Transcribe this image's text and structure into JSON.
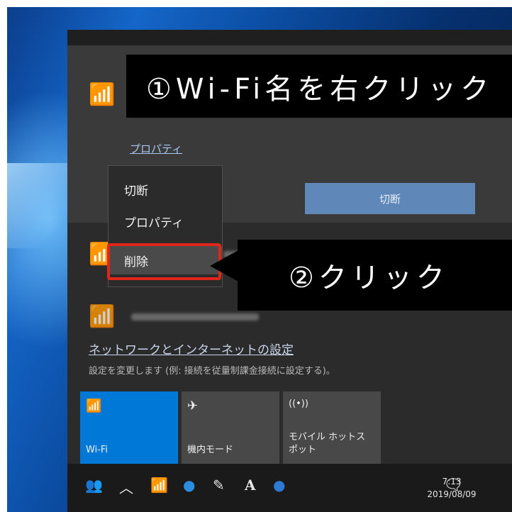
{
  "callouts": {
    "step1": "①Wi-Fi名を右クリック",
    "step2": "②クリック"
  },
  "flyout": {
    "property_link": "プロパティ",
    "disconnect_button": "切断",
    "context_menu": {
      "items": [
        {
          "label": "切断"
        },
        {
          "label": "プロパティ"
        },
        {
          "label": "削除"
        }
      ],
      "highlighted": "削除"
    },
    "settings_link": "ネットワークとインターネットの設定",
    "settings_desc": "設定を変更します (例: 接続を従量制課金接続に設定する)。",
    "tiles": [
      {
        "icon": "wifi-icon",
        "label": "Wi-Fi",
        "active": true
      },
      {
        "icon": "airplane-icon",
        "label": "機内モード",
        "active": false
      },
      {
        "icon": "hotspot-icon",
        "label": "モバイル ホットス\nポット",
        "active": false
      }
    ]
  },
  "taskbar": {
    "icons": [
      "people-icon",
      "chevron-up-icon",
      "wifi-icon",
      "bluetooth-icon",
      "pen-icon",
      "ime-icon",
      "globe-icon"
    ],
    "ime_label": "A",
    "time": "7:13",
    "date": "2019/08/09"
  },
  "colors": {
    "accent": "#0078d7",
    "highlight_box": "#e0261a",
    "callout_bg": "#000000"
  }
}
